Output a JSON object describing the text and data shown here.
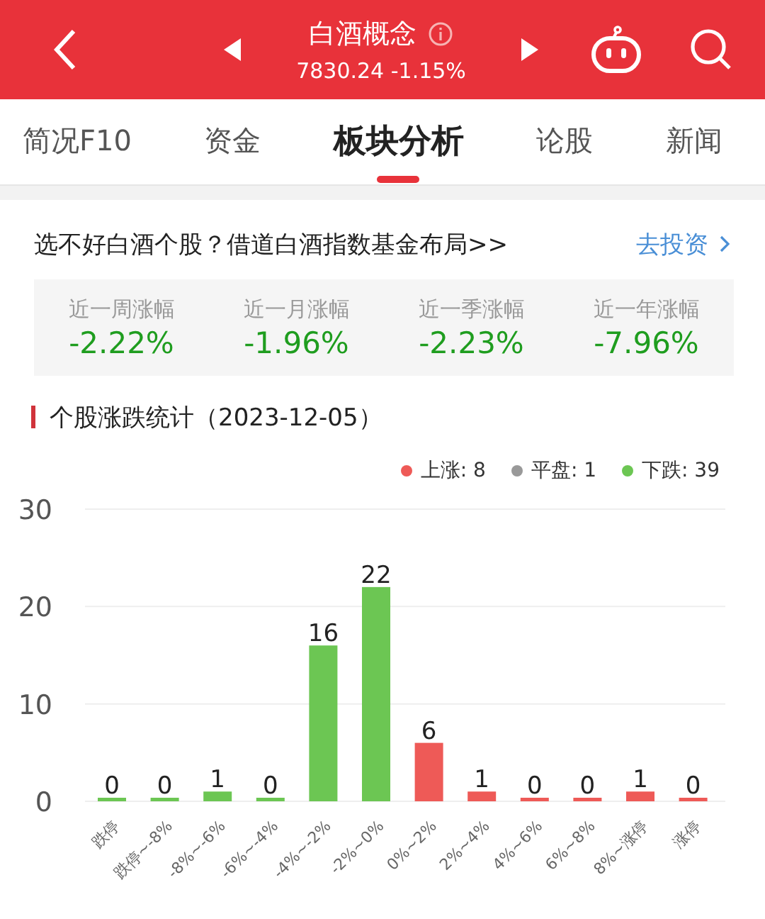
{
  "header": {
    "title": "白酒概念",
    "quote": "7830.24 -1.15%"
  },
  "tabs": [
    {
      "label": "简况F10",
      "selected": false
    },
    {
      "label": "资金",
      "selected": false
    },
    {
      "label": "板块分析",
      "selected": true
    },
    {
      "label": "论股",
      "selected": false
    },
    {
      "label": "新闻",
      "selected": false
    }
  ],
  "promo": {
    "text": "选不好白酒个股？借道白酒指数基金布局>>",
    "link": "去投资"
  },
  "stats": [
    {
      "label": "近一周涨幅",
      "value": "-2.22%"
    },
    {
      "label": "近一月涨幅",
      "value": "-1.96%"
    },
    {
      "label": "近一季涨幅",
      "value": "-2.23%"
    },
    {
      "label": "近一年涨幅",
      "value": "-7.96%"
    }
  ],
  "section": {
    "title": "个股涨跌统计（2023-12-05）",
    "legend": [
      {
        "label": "上涨: 8",
        "color": "#ee5a57"
      },
      {
        "label": "平盘: 1",
        "color": "#999999"
      },
      {
        "label": "下跌: 39",
        "color": "#6cc653"
      }
    ],
    "chart_data": {
      "type": "bar",
      "categories": [
        "跌停",
        "跌停~-8%",
        "-8%~-6%",
        "-6%~-4%",
        "-4%~-2%",
        "-2%~0%",
        "0%~2%",
        "2%~4%",
        "4%~6%",
        "6%~8%",
        "8%~涨停",
        "涨停"
      ],
      "series": [
        {
          "color": "#6cc653",
          "values": [
            0,
            0,
            1,
            0,
            16,
            22,
            null,
            null,
            null,
            null,
            null,
            null
          ]
        },
        {
          "color": "#ee5a57",
          "values": [
            null,
            null,
            null,
            null,
            null,
            null,
            6,
            1,
            0,
            0,
            1,
            0
          ]
        }
      ],
      "ylim": [
        0,
        30
      ],
      "yticks": [
        0,
        10,
        20,
        30
      ],
      "data_labels": true
    }
  }
}
